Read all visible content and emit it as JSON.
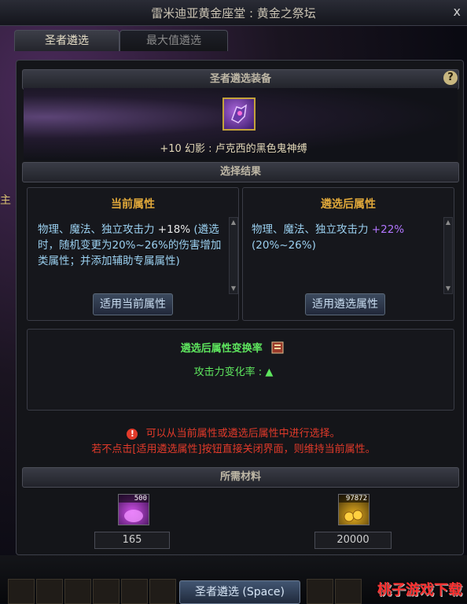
{
  "window": {
    "title": "雷米迪亚黄金座堂 : 黄金之祭坛",
    "close_glyph": "x"
  },
  "tabs": [
    {
      "label": "圣者遴选",
      "active": true
    },
    {
      "label": "最大值遴选",
      "active": false
    }
  ],
  "side_char": "主",
  "equipment": {
    "section_title": "圣者遴选装备",
    "help_glyph": "?",
    "item_name": "+10 幻影 : 卢克西的黑色鬼神缚"
  },
  "result": {
    "section_title": "选择结果",
    "current": {
      "title": "当前属性",
      "text_prefix": "物理、魔法、独立攻击力",
      "pct": "+18%",
      "text_suffix": "(遴选时，随机变更为20%~26%的伤害增加类属性；并添加辅助专属属性)",
      "button": "适用当前属性"
    },
    "after": {
      "title": "遴选后属性",
      "text_prefix": "物理、魔法、独立攻击力",
      "pct": "+22%",
      "text_suffix": "(20%~26%)",
      "button": "适用遴选属性"
    }
  },
  "change_rate": {
    "title": "遴选后属性变换率",
    "line": "攻击力变化率 : ▲"
  },
  "notice": {
    "icon": "!",
    "line1": "可以从当前属性或遴选后属性中进行选择。",
    "line2": "若不点击[适用遴选属性]按钮直接关闭界面，则维持当前属性。"
  },
  "materials": {
    "section_title": "所需材料",
    "items": [
      {
        "count_badge": "500",
        "quantity": "165"
      },
      {
        "count_badge": "97872",
        "quantity": "20000"
      }
    ]
  },
  "action_button": "圣者遴选 (Space)",
  "watermark": "桃子游戏下载",
  "colors": {
    "accent_gold": "#e0a83a",
    "green": "#5ee65e",
    "red": "#e23a2a",
    "blue_text": "#9bd0f0",
    "purple": "#b276ff"
  }
}
